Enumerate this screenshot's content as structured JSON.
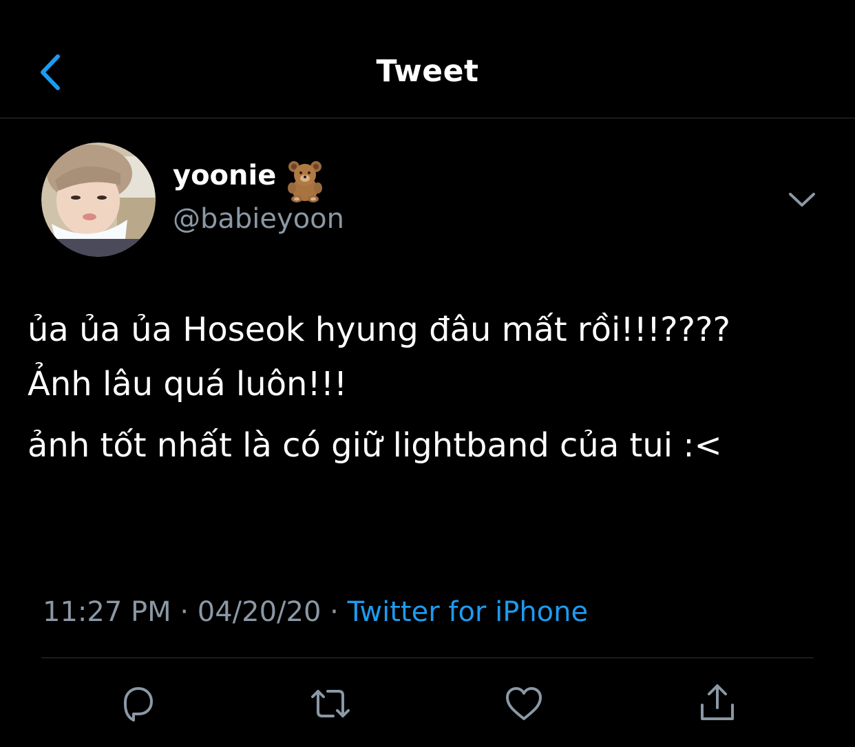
{
  "header": {
    "title": "Tweet",
    "accent_color": "#1d9bf0"
  },
  "author": {
    "display_name": "yoonie",
    "name_emoji": "teddy-bear-icon",
    "handle": "@babieyoon"
  },
  "tweet": {
    "lines_paragraph_1": [
      "ủa ủa ủa Hoseok hyung đâu mất rồi!!!????",
      "Ảnh lâu quá luôn!!!"
    ],
    "paragraph_2": "ảnh tốt nhất là có giữ lightband của tui :<"
  },
  "meta": {
    "time": "11:27 PM",
    "separator": "·",
    "date": "04/20/20",
    "source": "Twitter for iPhone"
  },
  "actions": [
    {
      "name": "reply",
      "icon": "reply-icon"
    },
    {
      "name": "retweet",
      "icon": "retweet-icon"
    },
    {
      "name": "like",
      "icon": "heart-icon"
    },
    {
      "name": "share",
      "icon": "share-icon"
    }
  ],
  "colors": {
    "background": "#000000",
    "text": "#ffffff",
    "secondary": "#8b98a5",
    "divider": "#2f3336",
    "link": "#1d9bf0"
  }
}
